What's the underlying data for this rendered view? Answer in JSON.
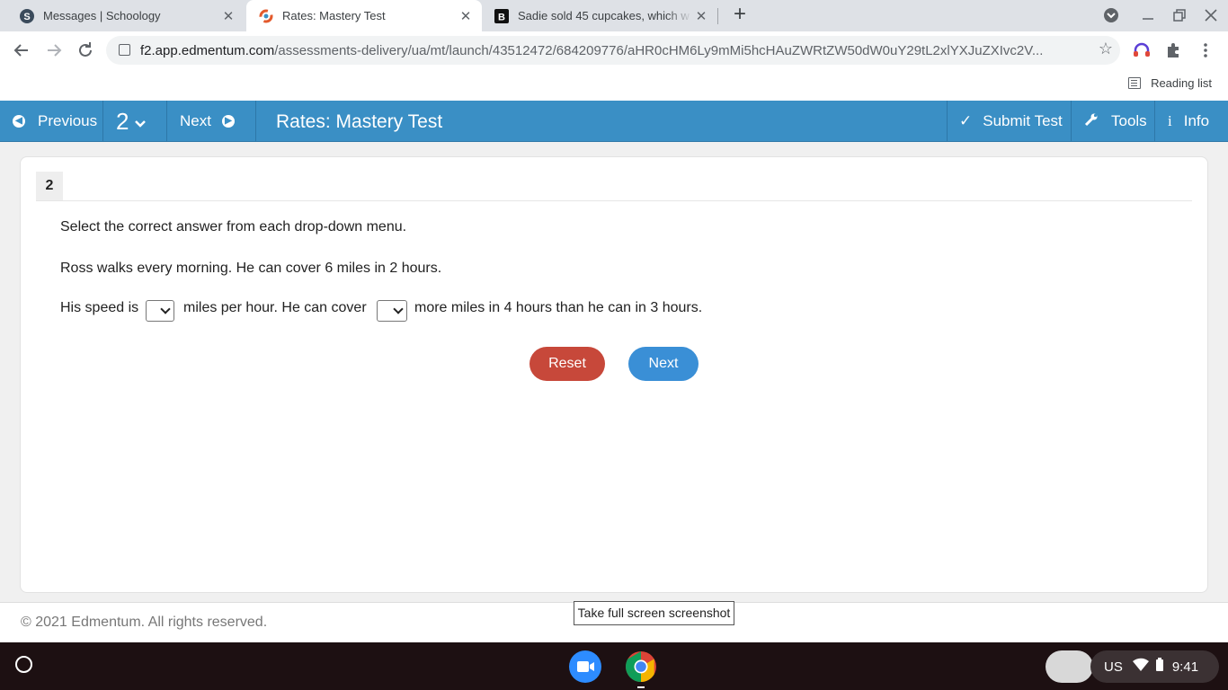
{
  "browser": {
    "tabs": [
      {
        "title": "Messages | Schoology",
        "active": false,
        "favicon": "schoology-icon"
      },
      {
        "title": "Rates: Mastery Test",
        "active": true,
        "favicon": "edmentum-icon"
      },
      {
        "title": "Sadie sold 45 cupcakes, which w",
        "active": false,
        "favicon": "brainly-icon"
      }
    ],
    "url_host": "f2.app.edmentum.com",
    "url_path": "/assessments-delivery/ua/mt/launch/43512472/684209776/aHR0cHM6Ly9mMi5hcHAuZWRtZW50dW0uY29tL2xlYXJuZXIvc2V...",
    "reading_list": "Reading list"
  },
  "header": {
    "previous": "Previous",
    "question_number": "2",
    "next": "Next",
    "title": "Rates: Mastery Test",
    "submit": "Submit Test",
    "tools": "Tools",
    "info": "Info"
  },
  "question": {
    "number": "2",
    "instruction": "Select the correct answer from each drop-down menu.",
    "prompt": "Ross walks every morning. He can cover 6 miles in 2 hours.",
    "part1": "His speed is",
    "part2": "miles per hour. He can cover",
    "part3": "more miles in 4 hours than he can in 3 hours.",
    "dropdown1_value": "",
    "dropdown2_value": "",
    "reset": "Reset",
    "next": "Next"
  },
  "footer": {
    "copyright": "© 2021 Edmentum. All rights reserved.",
    "tooltip": "Take full screen screenshot"
  },
  "shelf": {
    "locale": "US",
    "time": "9:41"
  },
  "colors": {
    "header_blue": "#3a8fc5",
    "reset_red": "#c7483a",
    "next_blue": "#3a8fd6"
  }
}
